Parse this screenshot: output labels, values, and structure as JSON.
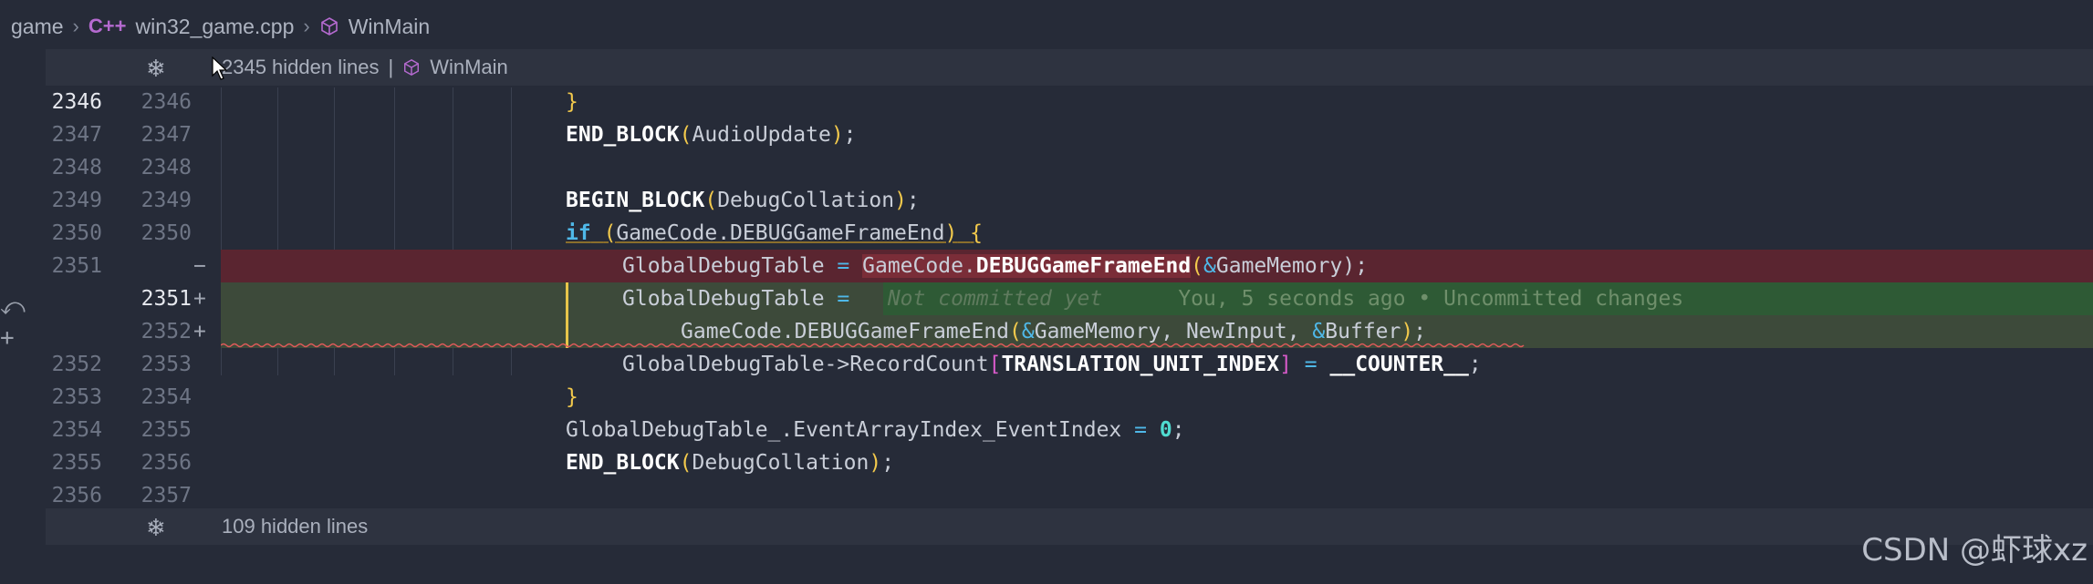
{
  "breadcrumb": {
    "root": "game",
    "file": "win32_game.cpp",
    "symbol": "WinMain",
    "file_icon": "cpp-file-icon",
    "symbol_icon": "cube-icon"
  },
  "fold_top": {
    "label": "2345 hidden lines",
    "separator": "|",
    "symbol": "WinMain"
  },
  "fold_bottom": {
    "label": "109 hidden lines"
  },
  "lines": [
    {
      "old": "2346",
      "new": "2346"
    },
    {
      "old": "2347",
      "new": "2347"
    },
    {
      "old": "2348",
      "new": "2348"
    },
    {
      "old": "2349",
      "new": "2349"
    },
    {
      "old": "2350",
      "new": "2350"
    },
    {
      "old": "2351",
      "new": "",
      "mark": "−"
    },
    {
      "old": "",
      "new": "2351",
      "mark": "+"
    },
    {
      "old": "",
      "new": "2352",
      "mark": "+"
    },
    {
      "old": "2352",
      "new": "2353"
    },
    {
      "old": "2353",
      "new": "2354"
    },
    {
      "old": "2354",
      "new": "2355"
    },
    {
      "old": "2355",
      "new": "2356"
    },
    {
      "old": "2356",
      "new": "2357"
    }
  ],
  "code": {
    "l1_brace": "}",
    "l2_macro": "END_BLOCK",
    "l2_arg": "AudioUpdate",
    "l4_macro": "BEGIN_BLOCK",
    "l4_arg": "DebugCollation",
    "l5_kw": "if",
    "l5_cond": "GameCode.DEBUGGameFrameEnd",
    "l5_brace": "{",
    "l6_lhs": "GlobalDebugTable",
    "l6_eq": "=",
    "l6_obj": "GameCode.",
    "l6_fn": "DEBUGGameFrameEnd",
    "l6_amp": "&",
    "l6_arg": "GameMemory",
    "l6_end": ");",
    "l7_lhs": "GlobalDebugTable",
    "l7_eq": "=",
    "l7_ghost": "Not committed yet",
    "l7_blame": "You, 5 seconds ago • Uncommitted changes",
    "l8_fn": "GameCode.DEBUGGameFrameEnd",
    "l8_amp1": "&",
    "l8_a1": "GameMemory",
    "l8_a2": "NewInput",
    "l8_amp2": "&",
    "l8_a3": "Buffer",
    "l8_end": ");",
    "l9_obj": "GlobalDebugTable->RecordCount",
    "l9_idx": "TRANSLATION_UNIT_INDEX",
    "l9_eq": "=",
    "l9_val": "__COUNTER__",
    "l10_brace": "}",
    "l11_lhs": "GlobalDebugTable_.EventArrayIndex_EventIndex",
    "l11_eq": "=",
    "l11_val": "0",
    "l12_macro": "END_BLOCK",
    "l12_arg": "DebugCollation"
  },
  "watermark": "CSDN @虾球xz"
}
